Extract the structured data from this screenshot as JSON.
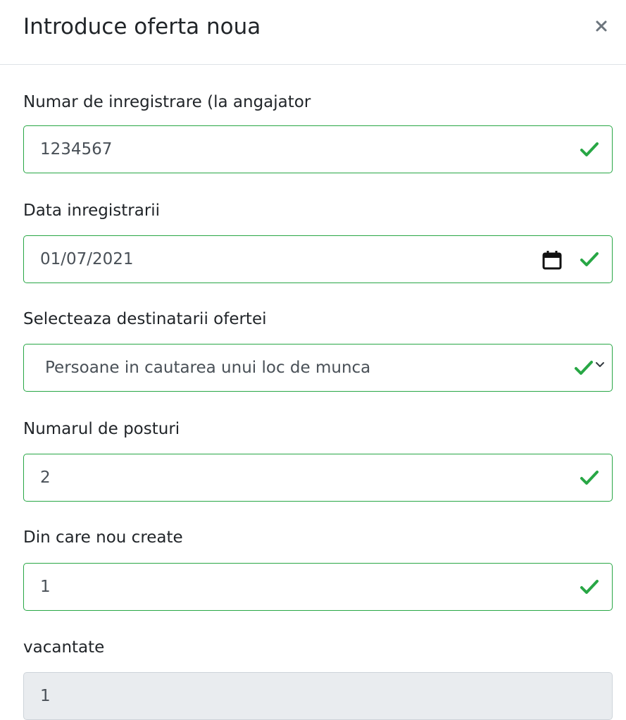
{
  "modal": {
    "title": "Introduce oferta noua",
    "close_symbol": "×",
    "close_icon": "close-icon"
  },
  "form": {
    "registration_number": {
      "label": "Numar de inregistrare (la angajator",
      "value": "1234567",
      "status_icon": "check-icon",
      "valid": true
    },
    "registration_date": {
      "label": "Data inregistrarii",
      "value": "01/07/2021",
      "picker_icon": "calendar-icon",
      "status_icon": "check-icon",
      "valid": true
    },
    "recipients": {
      "label": "Selecteaza destinatarii ofertei",
      "selected": "Persoane in cautarea unui loc de munca",
      "status_icon": "check-icon",
      "dropdown_icon": "chevron-down-icon",
      "valid": true
    },
    "positions_count": {
      "label": "Numarul de posturi",
      "value": "2",
      "status_icon": "check-icon",
      "valid": true
    },
    "newly_created": {
      "label": "Din care nou create",
      "value": "1",
      "status_icon": "check-icon",
      "valid": true
    },
    "vacancies": {
      "label": "vacantate",
      "value": "1",
      "disabled": true
    }
  },
  "colors": {
    "valid": "#28a745",
    "disabled_bg": "#e9ecef",
    "text": "#212529",
    "input_text": "#495057"
  }
}
